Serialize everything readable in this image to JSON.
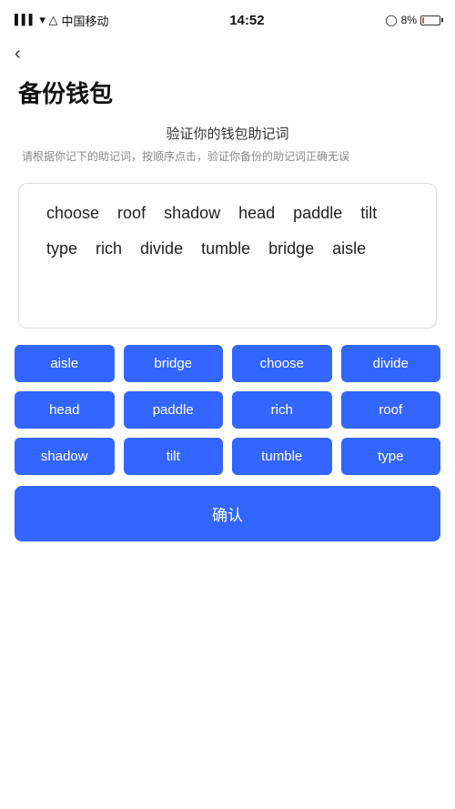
{
  "statusBar": {
    "carrier": "中国移动",
    "time": "14:52",
    "battery": "8%",
    "wifi": true
  },
  "backButton": {
    "label": "‹"
  },
  "pageTitle": "备份钱包",
  "subtitleMain": "验证你的钱包助记词",
  "subtitleDesc": "请根据你记下的助记词，按顺序点击，验证你备份的助记词正确无误",
  "displayedWords": [
    "choose",
    "roof",
    "shadow",
    "head",
    "paddle",
    "tilt",
    "type",
    "rich",
    "divide",
    "tumble",
    "bridge",
    "aisle"
  ],
  "wordButtons": [
    "aisle",
    "bridge",
    "choose",
    "divide",
    "head",
    "paddle",
    "rich",
    "roof",
    "shadow",
    "tilt",
    "tumble",
    "type"
  ],
  "confirmButton": "确认"
}
